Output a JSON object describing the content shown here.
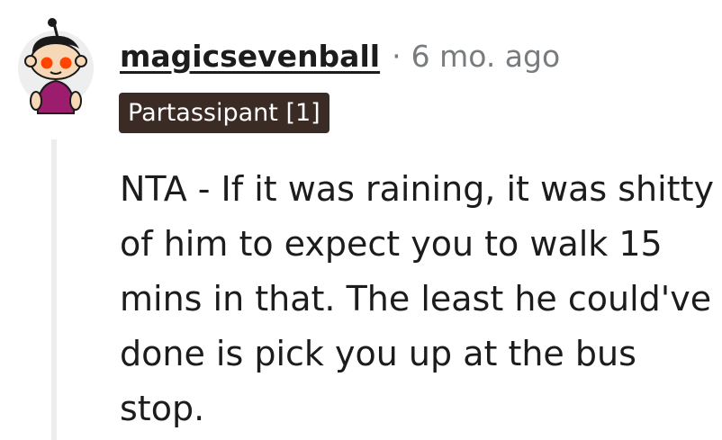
{
  "comment": {
    "author": "magicsevenball",
    "separator": "·",
    "age": "6 mo. ago",
    "flair": "Partassipant [1]",
    "body": "NTA - If it was raining, it was shitty of him to expect you to walk 15 mins in that. The least he could've done is pick you up at the bus stop.",
    "avatar_icon": "snoo-avatar-icon",
    "colors": {
      "flair_background": "#3a2b25",
      "muted_text": "#787c7e",
      "thread_line": "#ededed"
    }
  }
}
